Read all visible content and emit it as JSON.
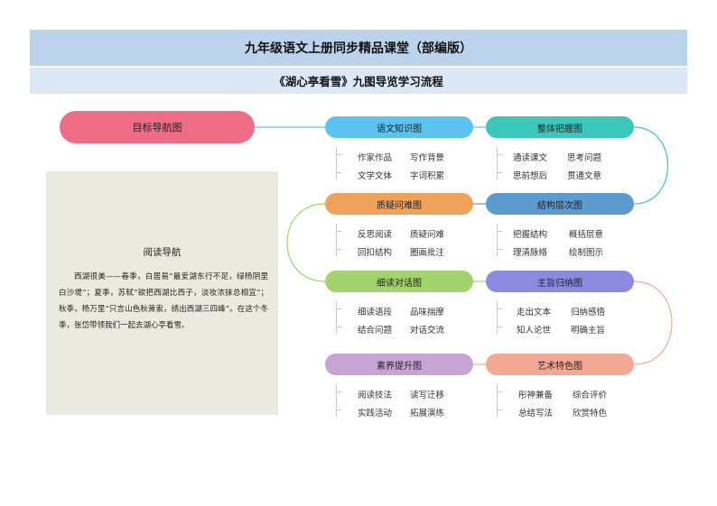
{
  "header": {
    "title": "九年级语文上册同步精品课堂（部编版）",
    "subtitle": "《湖心亭看雪》九图导览学习流程"
  },
  "goal": {
    "label": "目标导航图",
    "color": "#ef6c86"
  },
  "nodes": [
    {
      "label": "语文知识图",
      "color": "#5bc4ee",
      "items": [
        "作家作品",
        "写作背景",
        "文学文体",
        "字词积累"
      ]
    },
    {
      "label": "整体把握图",
      "color": "#3cc7bb",
      "items": [
        "通读课文",
        "思考问题",
        "思前想后",
        "贯通文意"
      ]
    },
    {
      "label": "结构层次图",
      "color": "#5b9bd0",
      "items": [
        "把握结构",
        "概括层意",
        "理清脉络",
        "绘制图示"
      ]
    },
    {
      "label": "质疑问难图",
      "color": "#f0a25a",
      "items": [
        "反思阅读",
        "质疑问难",
        "回扣结构",
        "圈画批注"
      ]
    },
    {
      "label": "细读对话图",
      "color": "#a3d36d",
      "items": [
        "细读语段",
        "品味揣摩",
        "结合问题",
        "对话交流"
      ]
    },
    {
      "label": "主旨归纳图",
      "color": "#8a8ae0",
      "items": [
        "走出文本",
        "归纳感悟",
        "知人论世",
        "明确主旨"
      ]
    },
    {
      "label": "艺术特色图",
      "color": "#f2a994",
      "items": [
        "彤神兼备",
        "综合评价",
        "总结写法",
        "欣赏特色"
      ]
    },
    {
      "label": "素养提升图",
      "color": "#c6a4d6",
      "items": [
        "阅读技法",
        "读写迁移",
        "实践活动",
        "拓展演练"
      ]
    }
  ],
  "reading": {
    "title": "阅读导航",
    "text": "西湖很美——春季，白居易“最爱湖东行不足，绿杨阴里白沙堤”；夏季，苏轼“欲把西湖比西子，淡妆浓抹总相宜”；秋季，杨万里“只言山色秋萧索，绣出西湖三四峰”。在这个冬季，张岱带领我们一起去湖心亭看雪。"
  },
  "colors": {
    "connector_blue": "#5bc4ee",
    "connector_teal": "#3cc7bb",
    "connector_green": "#a3d36d",
    "connector_pink": "#f2a994"
  }
}
